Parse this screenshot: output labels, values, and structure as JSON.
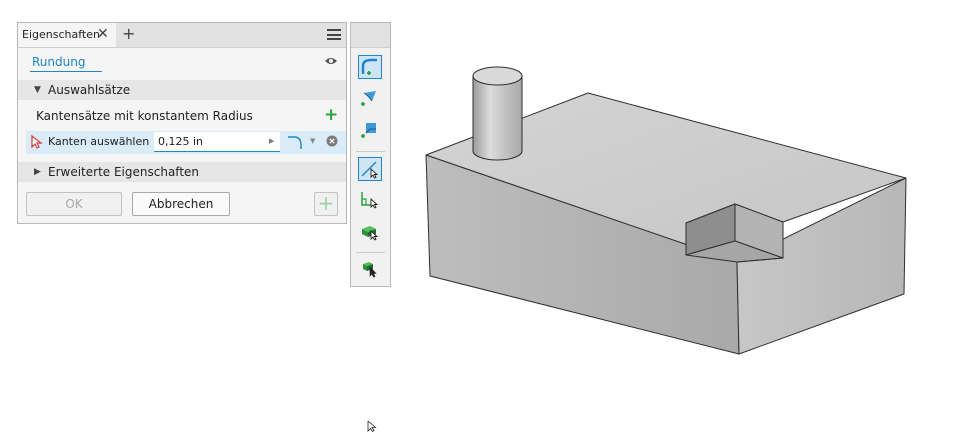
{
  "panel": {
    "tab_label": "Eigenschaften",
    "tab_close": "✕",
    "tab_add": "+",
    "title": "Rundung",
    "section_selection": "Auswahlsätze",
    "constant_radius_label": "Kantensätze mit konstantem Radius",
    "add_set": "+",
    "select_edges_label": "Kanten auswählen",
    "radius_value": "0,125 in",
    "section_advanced": "Erweiterte Eigenschaften",
    "ok_label": "OK",
    "cancel_label": "Abbrechen",
    "apply_label": "+"
  },
  "icons": {
    "menu": "hamburger-menu-icon",
    "visibility": "eye-icon",
    "select_arrow": "select-arrow-icon",
    "fillet_type": "fillet-profile-icon",
    "clear": "clear-circle-icon"
  },
  "toolbar": {
    "buttons": [
      "fillet-edge-icon",
      "face-fillet-icon",
      "full-round-fillet-icon",
      "select-edge-icon",
      "select-loop-icon",
      "select-feature-icon",
      "select-solid-icon"
    ]
  },
  "colors": {
    "accent": "#1f86c9",
    "add_green": "#29a33b",
    "select_red": "#d63a3a"
  }
}
